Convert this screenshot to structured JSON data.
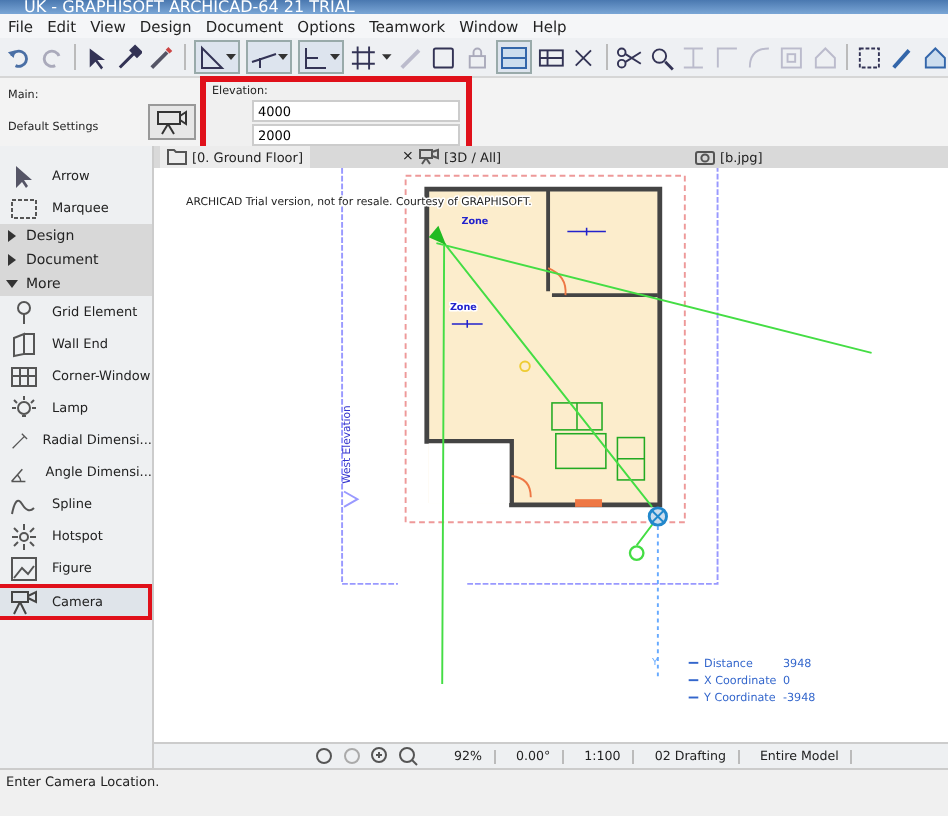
{
  "window": {
    "title": "UK - GRAPHISOFT ARCHICAD-64 21 TRIAL"
  },
  "menu": [
    "File",
    "Edit",
    "View",
    "Design",
    "Document",
    "Options",
    "Teamwork",
    "Window",
    "Help"
  ],
  "info_box": {
    "main_label": "Main:",
    "settings_label": "Default Settings",
    "elevation_label": "Elevation:",
    "values": [
      "4000",
      "2000"
    ]
  },
  "toolbox": {
    "items": [
      {
        "kind": "tool",
        "label": "Arrow",
        "selected": false
      },
      {
        "kind": "tool",
        "label": "Marquee",
        "selected": false
      },
      {
        "kind": "group",
        "label": "Design",
        "expanded": false
      },
      {
        "kind": "group",
        "label": "Document",
        "expanded": false
      },
      {
        "kind": "group",
        "label": "More",
        "expanded": true
      },
      {
        "kind": "tool",
        "label": "Grid Element",
        "selected": false
      },
      {
        "kind": "tool",
        "label": "Wall End",
        "selected": false
      },
      {
        "kind": "tool",
        "label": "Corner-Window",
        "selected": false
      },
      {
        "kind": "tool",
        "label": "Lamp",
        "selected": false
      },
      {
        "kind": "tool",
        "label": "Radial Dimensi...",
        "selected": false
      },
      {
        "kind": "tool",
        "label": "Angle Dimensi...",
        "selected": false
      },
      {
        "kind": "tool",
        "label": "Spline",
        "selected": false
      },
      {
        "kind": "tool",
        "label": "Hotspot",
        "selected": false
      },
      {
        "kind": "tool",
        "label": "Figure",
        "selected": false
      },
      {
        "kind": "tool",
        "label": "Camera",
        "selected": true
      }
    ]
  },
  "tab_close": "×",
  "tabs": [
    {
      "label": "[0. Ground Floor]",
      "selected": true
    },
    {
      "label": "[3D / All]",
      "selected": false
    },
    {
      "label": "[b.jpg]",
      "selected": false
    }
  ],
  "canvas": {
    "notice": "ARCHICAD Trial version, not for resale. Courtesy of GRAPHISOFT.",
    "side_label": "West Elevation",
    "zones": [
      "Zone",
      "Zone"
    ],
    "axis_label": "Y",
    "tracker": [
      {
        "label": "Distance",
        "value": "3948"
      },
      {
        "label": "X Coordinate",
        "value": "0"
      },
      {
        "label": "Y Coordinate",
        "value": "-3948"
      }
    ]
  },
  "status_bar": {
    "zoom": "92%",
    "angle": "0.00°",
    "scale": "1:100",
    "layer": "02 Drafting",
    "model": "Entire Model"
  },
  "prompt": "Enter Camera Location."
}
